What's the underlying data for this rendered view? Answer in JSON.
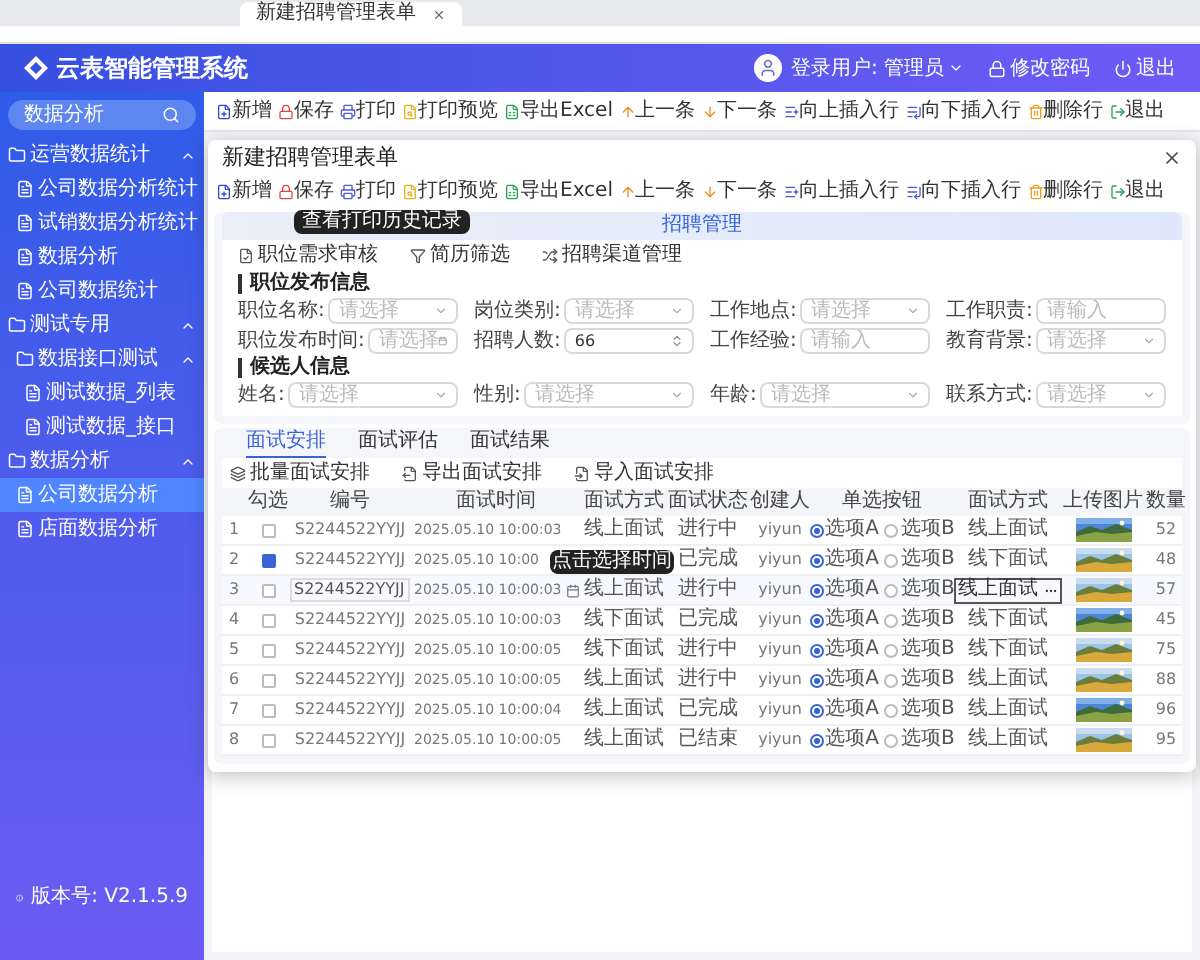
{
  "browser": {
    "tab_title": "新建招聘管理表单"
  },
  "header": {
    "title": "云表智能管理系统",
    "user": "登录用户: 管理员",
    "change_password": "修改密码",
    "logout": "退出"
  },
  "sidebar": {
    "search": {
      "value": "数据分析"
    },
    "items": [
      {
        "label": "运营数据统计",
        "selected": false,
        "expanded": true,
        "children": [
          {
            "label": "公司数据分析统计",
            "selected": false
          },
          {
            "label": "试销数据分析统计",
            "selected": false
          },
          {
            "label": "数据分析",
            "selected": false
          },
          {
            "label": "公司数据统计",
            "selected": false
          }
        ]
      },
      {
        "label": "测试专用",
        "selected": false,
        "expanded": true,
        "children": [
          {
            "label": "数据接口测试",
            "selected": false,
            "expanded": true,
            "children": [
              {
                "label": "测试数据_列表",
                "selected": false
              },
              {
                "label": "测试数据_接口",
                "selected": false
              }
            ]
          }
        ]
      },
      {
        "label": "数据分析",
        "selected": false,
        "expanded": true,
        "children": [
          {
            "label": "公司数据分析",
            "selected": true
          },
          {
            "label": "店面数据分析",
            "selected": false
          }
        ]
      }
    ],
    "version": "版本号: V2.1.5.9"
  },
  "page_toolbar": [
    "新增",
    "保存",
    "打印",
    "打印预览",
    "导出Excel",
    "上一条",
    "下一条",
    "向上插入行",
    "向下插入行",
    "删除行",
    "退出"
  ],
  "dialog": {
    "title": "新建招聘管理表单",
    "toolbar": [
      "新增",
      "保存",
      "打印",
      "打印预览",
      "导出Excel",
      "上一条",
      "下一条",
      "向上插入行",
      "向下插入行",
      "删除行",
      "退出"
    ],
    "tooltip": "查看打印历史记录",
    "banner": "招聘管理",
    "actions": [
      "职位需求审核",
      "简历筛选",
      "招聘渠道管理"
    ],
    "sections": [
      {
        "title": "职位发布信息",
        "fields": [
          {
            "label": "职位名称:",
            "kind": "select",
            "placeholder": "请选择"
          },
          {
            "label": "岗位类别:",
            "kind": "select",
            "placeholder": "请选择"
          },
          {
            "label": "工作地点:",
            "kind": "select",
            "placeholder": "请选择"
          },
          {
            "label": "工作职责:",
            "kind": "input",
            "placeholder": "请输入"
          },
          {
            "label": "职位发布时间:",
            "kind": "date",
            "placeholder": "请选择"
          },
          {
            "label": "招聘人数:",
            "kind": "number",
            "value": "66"
          },
          {
            "label": "工作经验:",
            "kind": "input",
            "placeholder": "请输入"
          },
          {
            "label": "教育背景:",
            "kind": "select",
            "placeholder": "请选择"
          }
        ]
      },
      {
        "title": "候选人信息",
        "fields": [
          {
            "label": "姓名:",
            "kind": "select",
            "placeholder": "请选择"
          },
          {
            "label": "性别:",
            "kind": "select",
            "placeholder": "请选择"
          },
          {
            "label": "年龄:",
            "kind": "select",
            "placeholder": "请选择"
          },
          {
            "label": "联系方式:",
            "kind": "select",
            "placeholder": "请选择"
          }
        ]
      }
    ],
    "tabs": [
      {
        "label": "面试安排",
        "selected": true
      },
      {
        "label": "面试评估",
        "selected": false
      },
      {
        "label": "面试结果",
        "selected": false
      }
    ],
    "table_actions": [
      "批量面试安排",
      "导出面试安排",
      "导入面试安排"
    ],
    "table": {
      "columns": [
        "勾选",
        "编号",
        "面试时间",
        "面试方式",
        "面试状态",
        "创建人",
        "单选按钮",
        "面试方式",
        "上传图片",
        "数量"
      ],
      "cell_tooltip": "点击选择时间",
      "rows": [
        {
          "index": "1",
          "checked": false,
          "editing": false,
          "id": "S2244522YYJJ",
          "time": "2025.05.10 10:00:03",
          "method": "线上面试",
          "status": "进行中",
          "creator": "yiyun",
          "options": [
            {
              "label": "选项A",
              "selected": true
            },
            {
              "label": "选项B",
              "selected": false
            }
          ],
          "method2": "线上面试",
          "quantity": "52"
        },
        {
          "index": "2",
          "checked": true,
          "editing": false,
          "id": "S2244522YYJJ",
          "time": "2025.05.10 10:00",
          "status": "已完成",
          "creator": "yiyun",
          "options": [
            {
              "label": "选项A",
              "selected": true
            },
            {
              "label": "选项B",
              "selected": false
            }
          ],
          "method2": "线下面试",
          "quantity": "48"
        },
        {
          "index": "3",
          "checked": false,
          "editing": true,
          "id": "S2244522YYJJ",
          "time": "2025.05.10 10:00:03",
          "method": "线上面试",
          "status": "进行中",
          "creator": "yiyun",
          "options": [
            {
              "label": "选项A",
              "selected": true
            },
            {
              "label": "选项B",
              "selected": false
            }
          ],
          "method2": "线上面试",
          "quantity": "57"
        },
        {
          "index": "4",
          "checked": false,
          "editing": false,
          "id": "S2244522YYJJ",
          "time": "2025.05.10 10:00:03",
          "method": "线下面试",
          "status": "已完成",
          "creator": "yiyun",
          "options": [
            {
              "label": "选项A",
              "selected": true
            },
            {
              "label": "选项B",
              "selected": false
            }
          ],
          "method2": "线下面试",
          "quantity": "45"
        },
        {
          "index": "5",
          "checked": false,
          "editing": false,
          "id": "S2244522YYJJ",
          "time": "2025.05.10 10:00:05",
          "method": "线下面试",
          "status": "进行中",
          "creator": "yiyun",
          "options": [
            {
              "label": "选项A",
              "selected": true
            },
            {
              "label": "选项B",
              "selected": false
            }
          ],
          "method2": "线下面试",
          "quantity": "75"
        },
        {
          "index": "6",
          "checked": false,
          "editing": false,
          "id": "S2244522YYJJ",
          "time": "2025.05.10 10:00:05",
          "method": "线上面试",
          "status": "进行中",
          "creator": "yiyun",
          "options": [
            {
              "label": "选项A",
              "selected": true
            },
            {
              "label": "选项B",
              "selected": false
            }
          ],
          "method2": "线上面试",
          "quantity": "88"
        },
        {
          "index": "7",
          "checked": false,
          "editing": false,
          "id": "S2244522YYJJ",
          "time": "2025.05.10 10:00:04",
          "method": "线上面试",
          "status": "已完成",
          "creator": "yiyun",
          "options": [
            {
              "label": "选项A",
              "selected": true
            },
            {
              "label": "选项B",
              "selected": false
            }
          ],
          "method2": "线上面试",
          "quantity": "96"
        },
        {
          "index": "8",
          "checked": false,
          "editing": false,
          "id": "S2244522YYJJ",
          "time": "2025.05.10 10:00:05",
          "method": "线上面试",
          "status": "已结束",
          "creator": "yiyun",
          "options": [
            {
              "label": "选项A",
              "selected": true
            },
            {
              "label": "选项B",
              "selected": false
            }
          ],
          "method2": "线上面试",
          "quantity": "95"
        }
      ]
    }
  }
}
